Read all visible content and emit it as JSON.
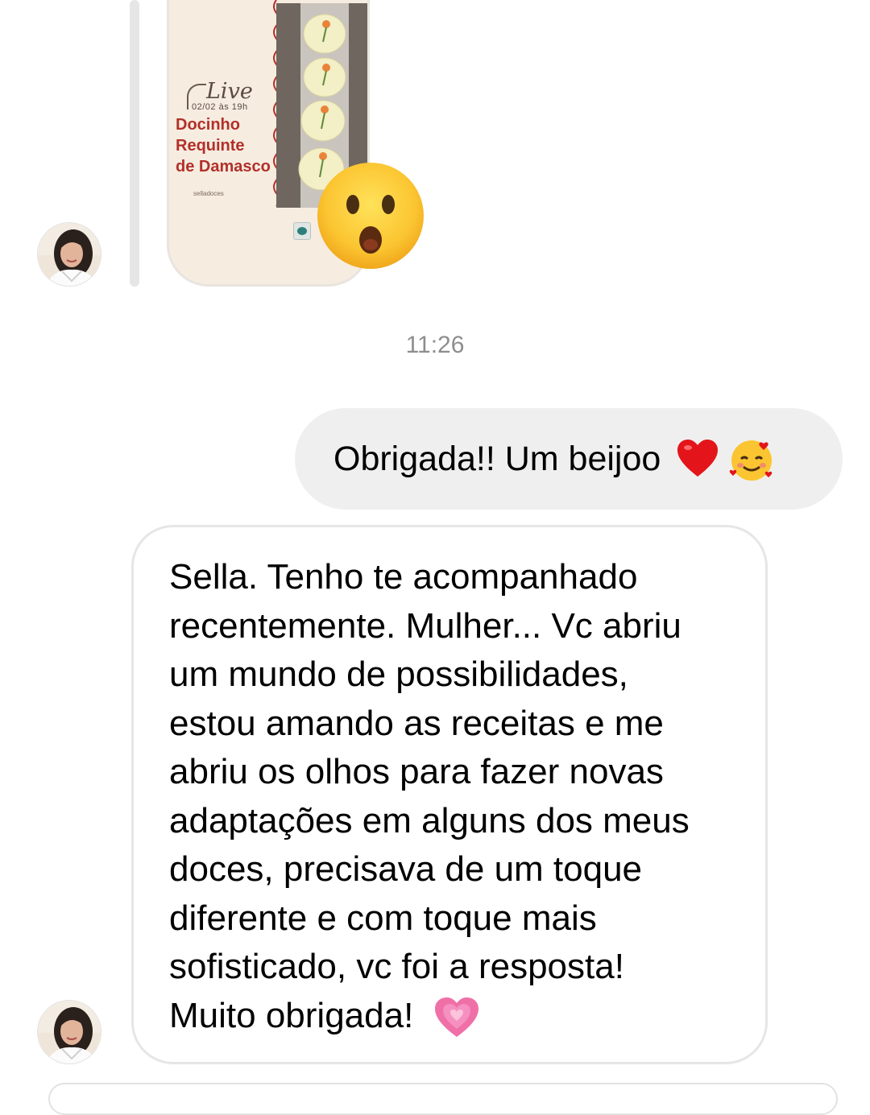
{
  "story_reply": {
    "card": {
      "live_label": "Live",
      "date_label": "02/02 às 19h",
      "title_lines": [
        "Docinho",
        "Requinte",
        "de Damasco"
      ],
      "brand_label": "selladoces",
      "title_color": "#b2302a"
    },
    "reaction": "astonished-face-emoji"
  },
  "timestamp": "11:26",
  "sent_message": {
    "text": "Obrigada!! Um beijoo",
    "emojis": [
      "red-heart-emoji",
      "smiling-face-with-hearts-emoji"
    ]
  },
  "received_message": {
    "lines": [
      "Sella. Tenho te acompanhado",
      "recentemente. Mulher... Vc abriu",
      "um mundo de possibilidades,",
      "estou amando as receitas e me",
      "abriu os olhos para fazer novas",
      "adaptações em alguns dos meus",
      "doces, precisava de um toque",
      "diferente e com toque mais",
      "sofisticado, vc foi a resposta!",
      "Muito obrigada!"
    ],
    "emoji": "growing-heart-emoji"
  },
  "colors": {
    "sent_bubble": "#efefef",
    "received_border": "#e6e6e6",
    "timestamp": "#8e8e8e"
  }
}
